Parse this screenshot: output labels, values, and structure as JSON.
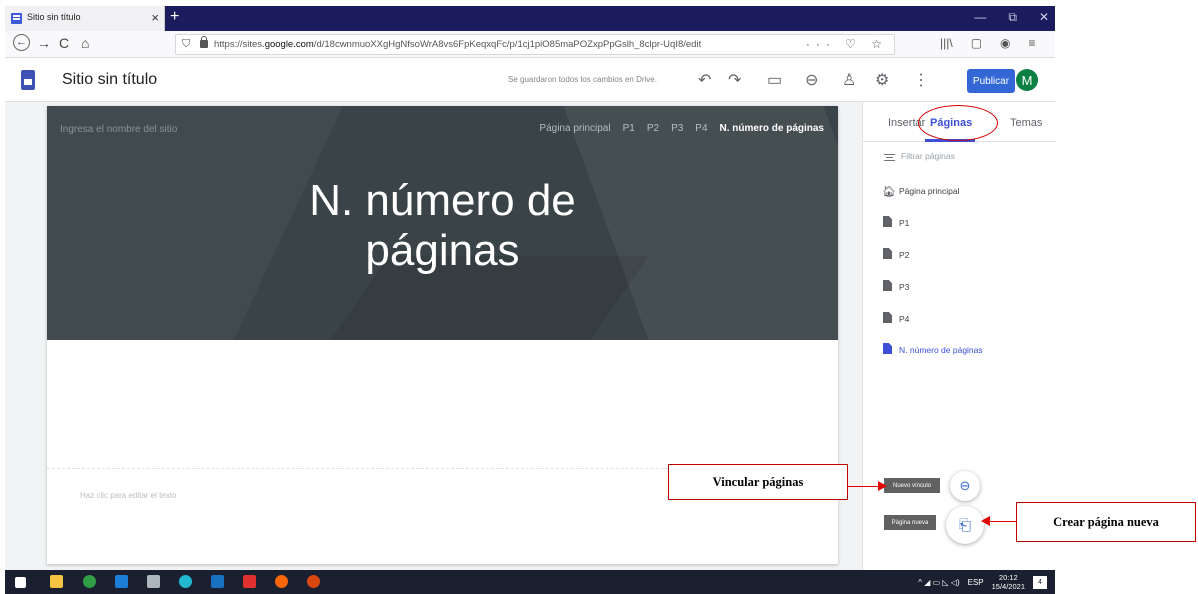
{
  "browser": {
    "tab_title": "Sitio sin título",
    "tab_close": "×",
    "new_tab": "+",
    "window_controls": [
      "—",
      "⧉",
      "✕"
    ],
    "url_prefix": "https://sites.",
    "url_domain": "google.com",
    "url_path": "/d/18cwnmuoXXgHgNfsoWrA8vs6FpKeqxqFc/p/1cj1piO85maPOZxpPpGslh_8clpr-UqI8/edit",
    "url_right_icons": "··· ♡ ☆",
    "nav_back": "←",
    "nav_forward": "→",
    "nav_reload": "C",
    "nav_home": "⌂",
    "toolbar_right": [
      "|||\\",
      "▢",
      "◉",
      "≡"
    ]
  },
  "app": {
    "title": "Sitio sin título",
    "saved_message": "Se guardaron todos los cambios en Drive.",
    "publish_label": "Publicar",
    "avatar_initial": "M",
    "tools": [
      "↶",
      "↷",
      "▭",
      "⊖",
      "♙",
      "⚙",
      "⋮"
    ]
  },
  "site": {
    "name_placeholder": "Ingresa el nombre del sitio",
    "nav": [
      "Página principal",
      "P1",
      "P2",
      "P3",
      "P4",
      "N. número de páginas"
    ],
    "hero_title_line1": "N. número de",
    "hero_title_line2": "páginas",
    "edit_hint": "Haz clic para editar el texto"
  },
  "panel": {
    "tabs": [
      "Insertar",
      "Páginas",
      "Temas"
    ],
    "selected_tab": "Páginas",
    "filter_placeholder": "Filtrar páginas",
    "pages": [
      "Página principal",
      "P1",
      "P2",
      "P3",
      "P4",
      "N. número de páginas"
    ],
    "current_page": "N. número de páginas"
  },
  "floating": {
    "new_link_tooltip": "Nuevo vínculo",
    "new_page_tooltip": "Página nueva"
  },
  "annotations": {
    "link_pages": "Vincular páginas",
    "create_page": "Crear página nueva",
    "color": "#e00000"
  },
  "taskbar": {
    "language": "ESP",
    "time": "20:12",
    "date": "15/4/2021",
    "notifications": "4"
  }
}
